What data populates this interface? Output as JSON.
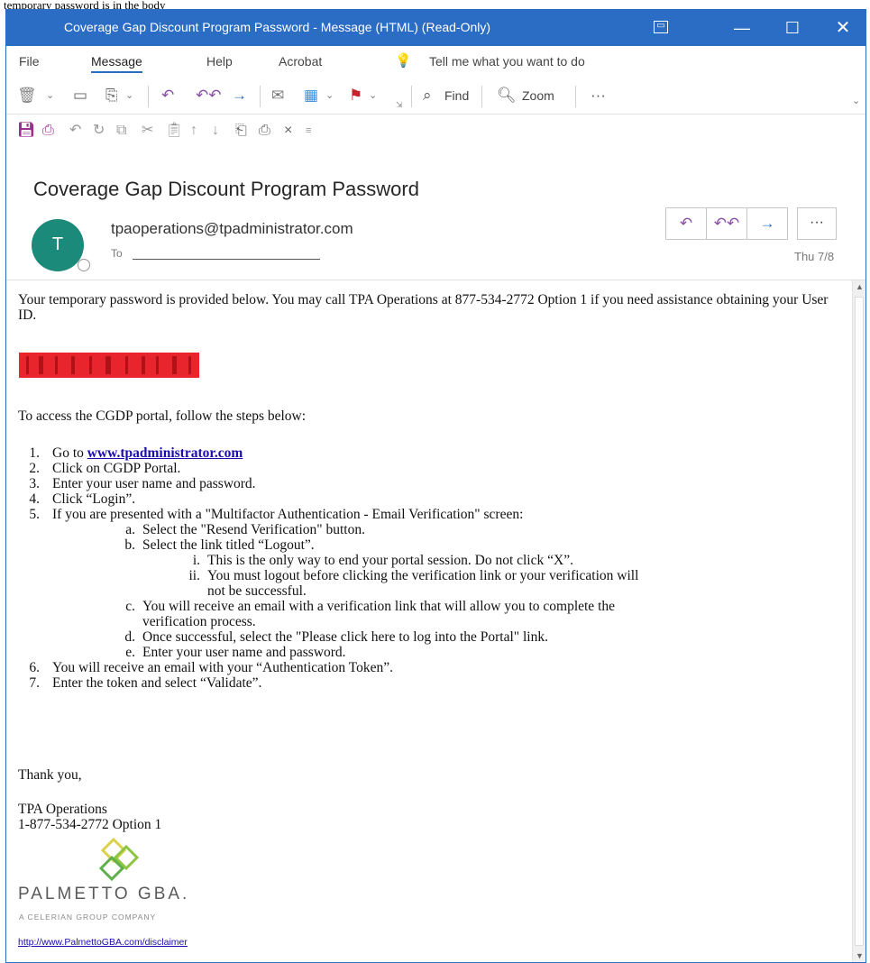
{
  "caption": "temporary password is in the body",
  "window": {
    "title": "Coverage Gap Discount Program Password  -  Message (HTML) (Read-Only)",
    "icon": "ribbon-display-icon",
    "controls": [
      "minimize",
      "maximize",
      "close"
    ]
  },
  "menu": {
    "items": [
      "File",
      "Message",
      "Help",
      "Acrobat"
    ],
    "active": "Message",
    "tell_me": "Tell me what you want to do"
  },
  "ribbon": {
    "find_label": "Find",
    "zoom_label": "Zoom",
    "more_label": "···"
  },
  "message": {
    "subject": "Coverage Gap Discount Program Password",
    "avatar_initial": "T",
    "sender": "tpaoperations@tpadministrator.com",
    "to_label": "To",
    "date": "Thu 7/8",
    "more_label": "···"
  },
  "body": {
    "intro": "Your temporary password is provided below. You may call TPA Operations at 877-534-2772 Option 1 if you need assistance obtaining your User ID.",
    "steps_intro": "To access the CGDP portal, follow the steps below:",
    "step1_prefix": "Go to ",
    "step1_link": "www.tpadministrator.com",
    "steps": {
      "s2": "Click on CGDP Portal.",
      "s3": "Enter your user name and password.",
      "s4": "Click “Login”.",
      "s5": "If you are presented with a \"Multifactor Authentication - Email Verification\" screen:",
      "s5a": "Select the \"Resend Verification\" button.",
      "s5b": "Select the link titled “Logout”.",
      "s5bi": "This is the only way to end your portal session. Do not click “X”.",
      "s5bii_1": "You must logout before clicking the verification link or your verification will",
      "s5bii_2": "not be successful.",
      "s5c_1": "You will receive an email with a verification link that will allow you to complete the",
      "s5c_2": "verification process.",
      "s5d": "Once successful, select the \"Please click here to log into the Portal\" link.",
      "s5e": "Enter your user name and password.",
      "s6": "You will receive an email with your “Authentication Token”.",
      "s7": "Enter the token and select “Validate”."
    },
    "markers": {
      "n1": "1.",
      "n2": "2.",
      "n3": "3.",
      "n4": "4.",
      "n5": "5.",
      "n6": "6.",
      "n7": "7.",
      "a": "a.",
      "b": "b.",
      "c": "c.",
      "d": "d.",
      "e": "e.",
      "i": "i.",
      "ii": "ii."
    },
    "thanks": "Thank you,",
    "signature_name": "TPA Operations",
    "signature_phone": "1-877-534-2772 Option 1",
    "logo_name": "PALMETTO GBA.",
    "logo_tagline": "A CELERIAN GROUP COMPANY",
    "disclaimer_link": "http://www.PalmettoGBA.com/disclaimer"
  },
  "colors": {
    "titlebar": "#2b6cc4",
    "avatar": "#1b8a7a",
    "redaction": "#e8242c",
    "link": "#1a0dab"
  }
}
